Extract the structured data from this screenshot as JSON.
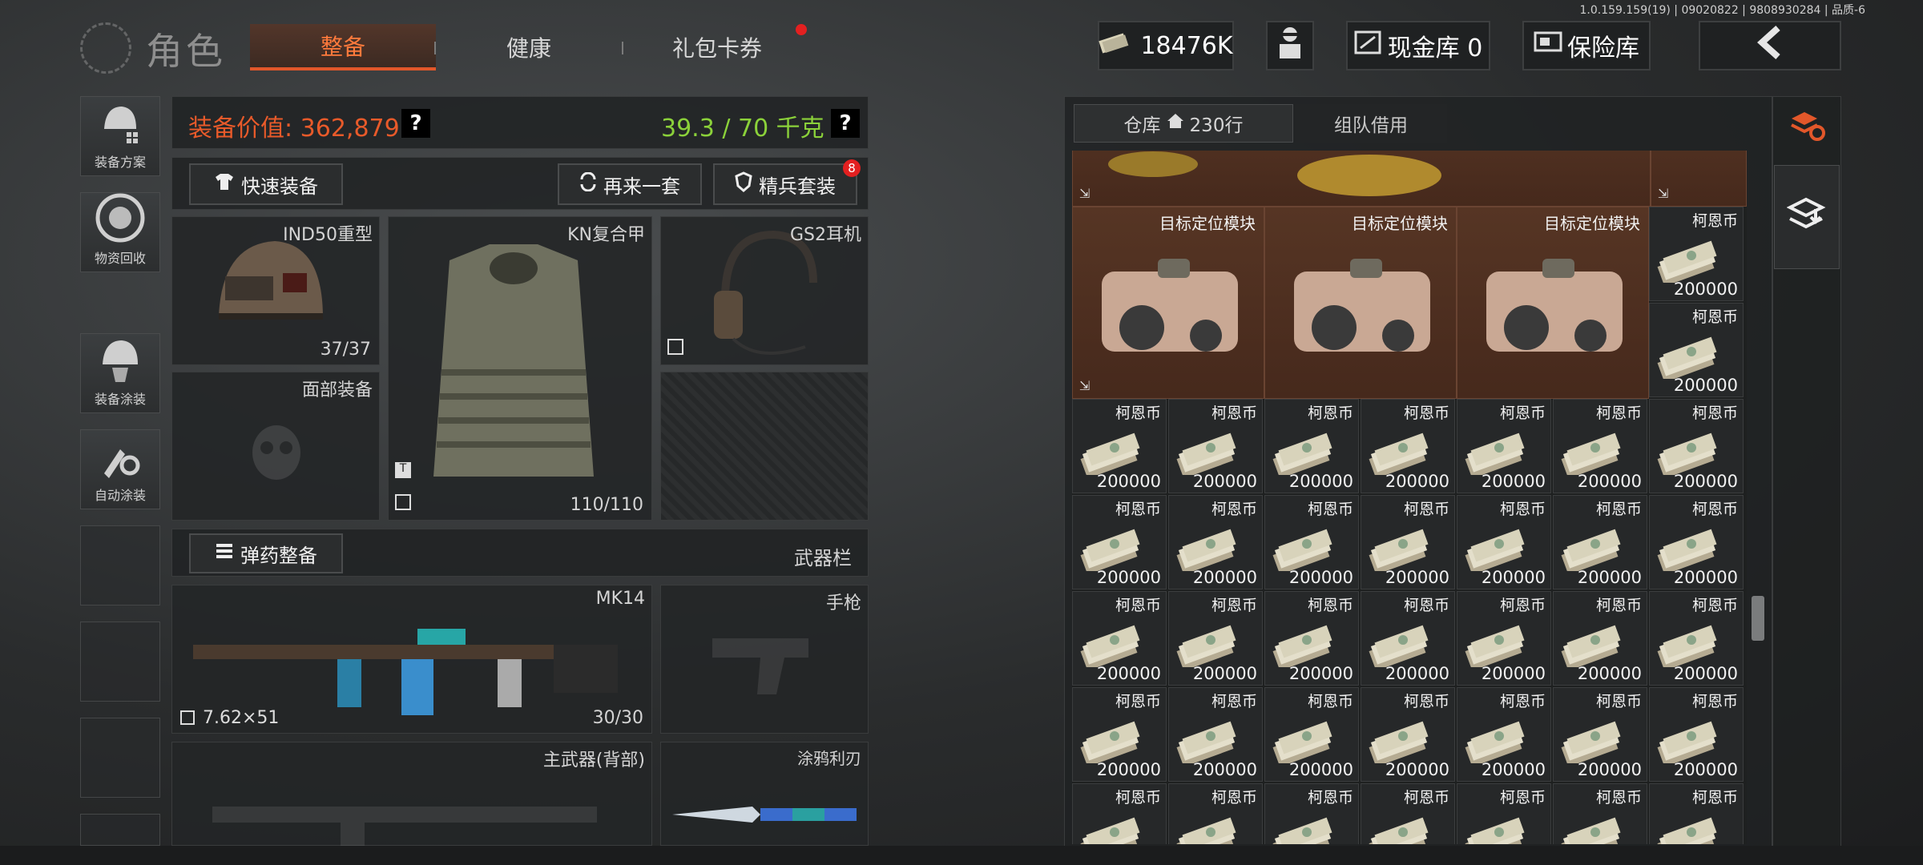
{
  "version": "1.0.159.159(19) | 09020822 | 9808930284 | 品质-6",
  "header": {
    "title": "角色",
    "tabs": [
      "整备",
      "健康",
      "礼包卡券"
    ],
    "money": "18476K",
    "cash_vault": "现金库 0",
    "insurance": "保险库"
  },
  "sidebar": [
    "装备方案",
    "物资回收",
    "装备涂装",
    "自动涂装"
  ],
  "equipment": {
    "value_label": "装备价值: 362,879",
    "weight": "39.3 / 70 千克",
    "quick_equip": "快速装备",
    "again": "再来一套",
    "elite": "精兵套装",
    "elite_badge": "8",
    "helmet": {
      "name": "IND50重型",
      "durability": "37/37"
    },
    "armor": {
      "name": "KN复合甲",
      "durability": "110/110"
    },
    "headset": {
      "name": "GS2耳机"
    },
    "face": {
      "name": "面部装备"
    },
    "ammo_btn": "弹药整备",
    "weapon_bar": "武器栏",
    "primary": {
      "name": "MK14",
      "ammo": "7.62×51",
      "count": "30/30"
    },
    "pistol": "手枪",
    "back_weapon": "主武器(背部)",
    "knife": "涂鸦利刃"
  },
  "warehouse": {
    "tab_label": "仓库",
    "rows": "230行",
    "team_tab": "组队借用",
    "module_name": "目标定位模块",
    "coin_name": "柯恩币",
    "coin_value": "200000"
  },
  "colors": {
    "accent": "#e2572a",
    "value": "#e85a2a",
    "weight": "#8bd13a",
    "brown": "#4e2f21"
  }
}
